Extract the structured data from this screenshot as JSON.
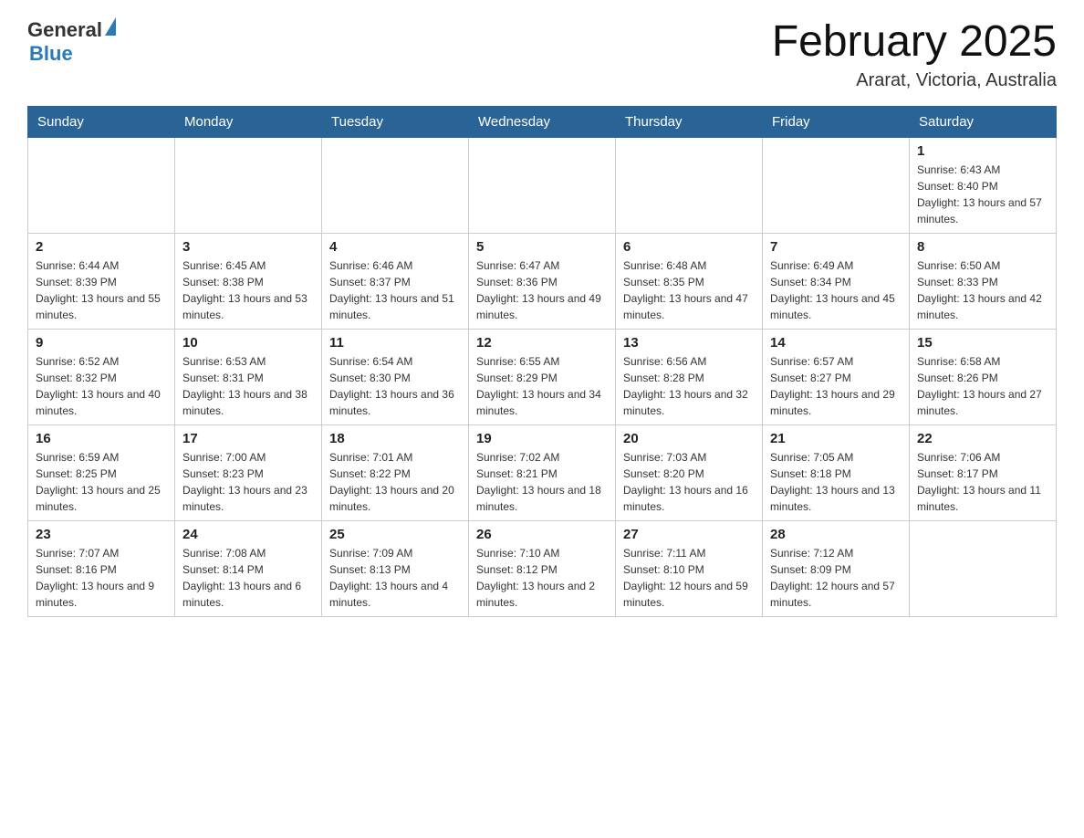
{
  "header": {
    "logo": {
      "general": "General",
      "blue": "Blue"
    },
    "month_title": "February 2025",
    "location": "Ararat, Victoria, Australia"
  },
  "weekdays": [
    "Sunday",
    "Monday",
    "Tuesday",
    "Wednesday",
    "Thursday",
    "Friday",
    "Saturday"
  ],
  "weeks": [
    [
      {
        "day": "",
        "info": ""
      },
      {
        "day": "",
        "info": ""
      },
      {
        "day": "",
        "info": ""
      },
      {
        "day": "",
        "info": ""
      },
      {
        "day": "",
        "info": ""
      },
      {
        "day": "",
        "info": ""
      },
      {
        "day": "1",
        "info": "Sunrise: 6:43 AM\nSunset: 8:40 PM\nDaylight: 13 hours and 57 minutes."
      }
    ],
    [
      {
        "day": "2",
        "info": "Sunrise: 6:44 AM\nSunset: 8:39 PM\nDaylight: 13 hours and 55 minutes."
      },
      {
        "day": "3",
        "info": "Sunrise: 6:45 AM\nSunset: 8:38 PM\nDaylight: 13 hours and 53 minutes."
      },
      {
        "day": "4",
        "info": "Sunrise: 6:46 AM\nSunset: 8:37 PM\nDaylight: 13 hours and 51 minutes."
      },
      {
        "day": "5",
        "info": "Sunrise: 6:47 AM\nSunset: 8:36 PM\nDaylight: 13 hours and 49 minutes."
      },
      {
        "day": "6",
        "info": "Sunrise: 6:48 AM\nSunset: 8:35 PM\nDaylight: 13 hours and 47 minutes."
      },
      {
        "day": "7",
        "info": "Sunrise: 6:49 AM\nSunset: 8:34 PM\nDaylight: 13 hours and 45 minutes."
      },
      {
        "day": "8",
        "info": "Sunrise: 6:50 AM\nSunset: 8:33 PM\nDaylight: 13 hours and 42 minutes."
      }
    ],
    [
      {
        "day": "9",
        "info": "Sunrise: 6:52 AM\nSunset: 8:32 PM\nDaylight: 13 hours and 40 minutes."
      },
      {
        "day": "10",
        "info": "Sunrise: 6:53 AM\nSunset: 8:31 PM\nDaylight: 13 hours and 38 minutes."
      },
      {
        "day": "11",
        "info": "Sunrise: 6:54 AM\nSunset: 8:30 PM\nDaylight: 13 hours and 36 minutes."
      },
      {
        "day": "12",
        "info": "Sunrise: 6:55 AM\nSunset: 8:29 PM\nDaylight: 13 hours and 34 minutes."
      },
      {
        "day": "13",
        "info": "Sunrise: 6:56 AM\nSunset: 8:28 PM\nDaylight: 13 hours and 32 minutes."
      },
      {
        "day": "14",
        "info": "Sunrise: 6:57 AM\nSunset: 8:27 PM\nDaylight: 13 hours and 29 minutes."
      },
      {
        "day": "15",
        "info": "Sunrise: 6:58 AM\nSunset: 8:26 PM\nDaylight: 13 hours and 27 minutes."
      }
    ],
    [
      {
        "day": "16",
        "info": "Sunrise: 6:59 AM\nSunset: 8:25 PM\nDaylight: 13 hours and 25 minutes."
      },
      {
        "day": "17",
        "info": "Sunrise: 7:00 AM\nSunset: 8:23 PM\nDaylight: 13 hours and 23 minutes."
      },
      {
        "day": "18",
        "info": "Sunrise: 7:01 AM\nSunset: 8:22 PM\nDaylight: 13 hours and 20 minutes."
      },
      {
        "day": "19",
        "info": "Sunrise: 7:02 AM\nSunset: 8:21 PM\nDaylight: 13 hours and 18 minutes."
      },
      {
        "day": "20",
        "info": "Sunrise: 7:03 AM\nSunset: 8:20 PM\nDaylight: 13 hours and 16 minutes."
      },
      {
        "day": "21",
        "info": "Sunrise: 7:05 AM\nSunset: 8:18 PM\nDaylight: 13 hours and 13 minutes."
      },
      {
        "day": "22",
        "info": "Sunrise: 7:06 AM\nSunset: 8:17 PM\nDaylight: 13 hours and 11 minutes."
      }
    ],
    [
      {
        "day": "23",
        "info": "Sunrise: 7:07 AM\nSunset: 8:16 PM\nDaylight: 13 hours and 9 minutes."
      },
      {
        "day": "24",
        "info": "Sunrise: 7:08 AM\nSunset: 8:14 PM\nDaylight: 13 hours and 6 minutes."
      },
      {
        "day": "25",
        "info": "Sunrise: 7:09 AM\nSunset: 8:13 PM\nDaylight: 13 hours and 4 minutes."
      },
      {
        "day": "26",
        "info": "Sunrise: 7:10 AM\nSunset: 8:12 PM\nDaylight: 13 hours and 2 minutes."
      },
      {
        "day": "27",
        "info": "Sunrise: 7:11 AM\nSunset: 8:10 PM\nDaylight: 12 hours and 59 minutes."
      },
      {
        "day": "28",
        "info": "Sunrise: 7:12 AM\nSunset: 8:09 PM\nDaylight: 12 hours and 57 minutes."
      },
      {
        "day": "",
        "info": ""
      }
    ]
  ]
}
